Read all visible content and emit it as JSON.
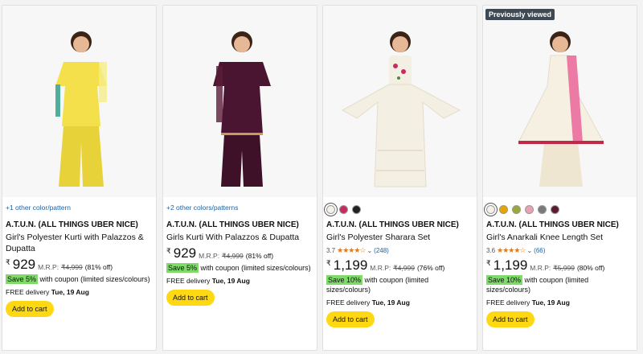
{
  "products": [
    {
      "variant_text": "+1 other color/pattern",
      "brand": "A.T.U.N. (ALL THINGS UBER NICE)",
      "title": "Girl's Polyester Kurti with Palazzos & Dupatta",
      "price": "929",
      "mrp_label": "M.R.P:",
      "mrp": "₹4,999",
      "discount": "(81% off)",
      "coupon_badge": "Save 5%",
      "coupon_text": "with coupon (limited sizes/colours)",
      "delivery_label": "FREE delivery",
      "delivery_date": "Tue, 19 Aug",
      "button": "Add to cart",
      "outfit_color": "#f3e04a"
    },
    {
      "variant_text": "+2 other colors/patterns",
      "brand": "A.T.U.N. (ALL THINGS UBER NICE)",
      "title": "Girls Kurti With Palazzos & Dupatta",
      "price": "929",
      "mrp_label": "M.R.P:",
      "mrp": "₹4,999",
      "discount": "(81% off)",
      "coupon_badge": "Save 5%",
      "coupon_text": "with coupon (limited sizes/colours)",
      "delivery_label": "FREE delivery",
      "delivery_date": "Tue, 19 Aug",
      "button": "Add to cart",
      "outfit_color": "#4a1530"
    },
    {
      "swatches": [
        "#f4f1e8",
        "#c72b5f",
        "#222222"
      ],
      "brand": "A.T.U.N. (ALL THINGS UBER NICE)",
      "title": "Girl's Polyester Sharara Set",
      "rating": "3.7",
      "stars": "★★★★☆",
      "rating_count": "(248)",
      "price": "1,199",
      "mrp_label": "M.R.P:",
      "mrp": "₹4,999",
      "discount": "(76% off)",
      "coupon_badge": "Save 10%",
      "coupon_text": "with coupon (limited sizes/colours)",
      "delivery_label": "FREE delivery",
      "delivery_date": "Tue, 19 Aug",
      "button": "Add to cart",
      "outfit_color": "#f4efe3"
    },
    {
      "badge": "Previously viewed",
      "swatches": [
        "#f4f1e8",
        "#e8a400",
        "#9aa83a",
        "#e7a2b4",
        "#7a7a7a",
        "#5a1a30"
      ],
      "brand": "A.T.U.N. (ALL THINGS UBER NICE)",
      "title": "Girl's Anarkali Knee Length Set",
      "rating": "3.6",
      "stars": "★★★★☆",
      "rating_count": "(66)",
      "price": "1,199",
      "mrp_label": "M.R.P:",
      "mrp": "₹5,999",
      "discount": "(80% off)",
      "coupon_badge": "Save 10%",
      "coupon_text": "with coupon (limited sizes/colours)",
      "delivery_label": "FREE delivery",
      "delivery_date": "Tue, 19 Aug",
      "button": "Add to cart",
      "outfit_color": "#f6f0e2"
    }
  ],
  "currency": "₹"
}
